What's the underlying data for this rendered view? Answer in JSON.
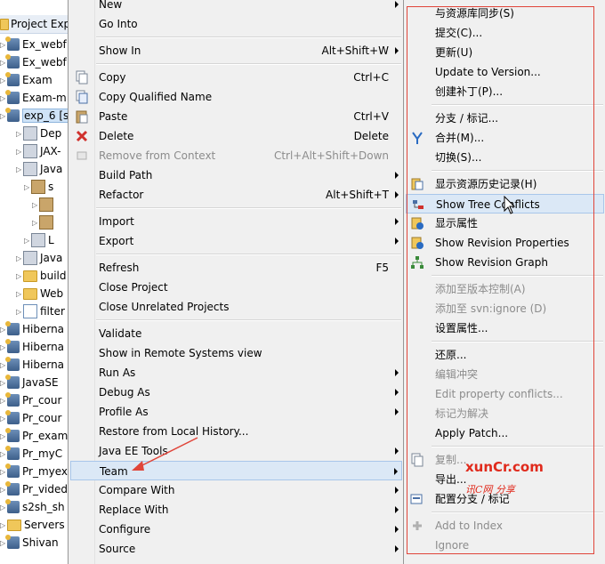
{
  "explorer": {
    "header": "Project Expl",
    "rows": [
      {
        "label": "Ex_webf",
        "indent": 0,
        "icon": "project-icon"
      },
      {
        "label": "Ex_webf",
        "indent": 0,
        "icon": "project-icon"
      },
      {
        "label": "Exam",
        "indent": 0,
        "icon": "project-icon"
      },
      {
        "label": "Exam-m",
        "indent": 0,
        "icon": "project-icon"
      },
      {
        "label": "exp_6 [s",
        "indent": 0,
        "icon": "project-icon",
        "selected": true
      },
      {
        "label": "Dep",
        "indent": 2,
        "icon": "library-icon"
      },
      {
        "label": "JAX-",
        "indent": 2,
        "icon": "library-icon"
      },
      {
        "label": "Java",
        "indent": 2,
        "icon": "library-icon"
      },
      {
        "label": "s",
        "indent": 3,
        "icon": "package-icon"
      },
      {
        "label": "",
        "indent": 4,
        "icon": "package-icon"
      },
      {
        "label": "",
        "indent": 4,
        "icon": "package-icon"
      },
      {
        "label": "L",
        "indent": 3,
        "icon": "library-icon"
      },
      {
        "label": "Java",
        "indent": 2,
        "icon": "library-icon"
      },
      {
        "label": "build",
        "indent": 2,
        "icon": "folder-icon"
      },
      {
        "label": "Web",
        "indent": 2,
        "icon": "folder-icon"
      },
      {
        "label": "filter",
        "indent": 2,
        "icon": "xml-icon"
      },
      {
        "label": "Hiberna",
        "indent": 0,
        "icon": "project-icon"
      },
      {
        "label": "Hiberna",
        "indent": 0,
        "icon": "project-icon"
      },
      {
        "label": "Hiberna",
        "indent": 0,
        "icon": "project-icon"
      },
      {
        "label": "JavaSE",
        "indent": 0,
        "icon": "project-icon"
      },
      {
        "label": "Pr_cour",
        "indent": 0,
        "icon": "project-icon"
      },
      {
        "label": "Pr_cour",
        "indent": 0,
        "icon": "project-icon"
      },
      {
        "label": "Pr_exam",
        "indent": 0,
        "icon": "project-icon"
      },
      {
        "label": "Pr_myC",
        "indent": 0,
        "icon": "project-icon"
      },
      {
        "label": "Pr_myex",
        "indent": 0,
        "icon": "project-icon"
      },
      {
        "label": "Pr_vided",
        "indent": 0,
        "icon": "project-icon"
      },
      {
        "label": "s2sh_sh",
        "indent": 0,
        "icon": "project-icon"
      },
      {
        "label": "Servers",
        "indent": 0,
        "icon": "folder-icon"
      },
      {
        "label": "Shivan",
        "indent": 0,
        "icon": "project-icon"
      }
    ]
  },
  "main_menu": {
    "items": [
      {
        "type": "item",
        "label": "New",
        "submenu": true
      },
      {
        "type": "item",
        "label": "Go Into"
      },
      {
        "type": "sep"
      },
      {
        "type": "item",
        "label": "Show In",
        "accel": "Alt+Shift+W",
        "submenu": true
      },
      {
        "type": "sep"
      },
      {
        "type": "item",
        "label": "Copy",
        "accel": "Ctrl+C",
        "icon": "copy-icon"
      },
      {
        "type": "item",
        "label": "Copy Qualified Name",
        "icon": "copy-qualified-icon"
      },
      {
        "type": "item",
        "label": "Paste",
        "accel": "Ctrl+V",
        "icon": "paste-icon"
      },
      {
        "type": "item",
        "label": "Delete",
        "accel": "Delete",
        "icon": "delete-icon"
      },
      {
        "type": "item",
        "label": "Remove from Context",
        "accel": "Ctrl+Alt+Shift+Down",
        "disabled": true,
        "icon": "remove-context-icon"
      },
      {
        "type": "item",
        "label": "Build Path",
        "submenu": true
      },
      {
        "type": "item",
        "label": "Refactor",
        "accel": "Alt+Shift+T",
        "submenu": true
      },
      {
        "type": "sep"
      },
      {
        "type": "item",
        "label": "Import",
        "submenu": true
      },
      {
        "type": "item",
        "label": "Export",
        "submenu": true
      },
      {
        "type": "sep"
      },
      {
        "type": "item",
        "label": "Refresh",
        "accel": "F5"
      },
      {
        "type": "item",
        "label": "Close Project"
      },
      {
        "type": "item",
        "label": "Close Unrelated Projects"
      },
      {
        "type": "sep"
      },
      {
        "type": "item",
        "label": "Validate"
      },
      {
        "type": "item",
        "label": "Show in Remote Systems view"
      },
      {
        "type": "item",
        "label": "Run As",
        "submenu": true
      },
      {
        "type": "item",
        "label": "Debug As",
        "submenu": true
      },
      {
        "type": "item",
        "label": "Profile As",
        "submenu": true
      },
      {
        "type": "item",
        "label": "Restore from Local History..."
      },
      {
        "type": "item",
        "label": "Java EE Tools",
        "submenu": true
      },
      {
        "type": "item",
        "label": "Team",
        "submenu": true,
        "highlight": true
      },
      {
        "type": "item",
        "label": "Compare With",
        "submenu": true
      },
      {
        "type": "item",
        "label": "Replace With",
        "submenu": true
      },
      {
        "type": "item",
        "label": "Configure",
        "submenu": true
      },
      {
        "type": "item",
        "label": "Source",
        "submenu": true
      }
    ]
  },
  "team_menu": {
    "items": [
      {
        "type": "item",
        "label": "与资源库同步(S)"
      },
      {
        "type": "item",
        "label": "提交(C)..."
      },
      {
        "type": "item",
        "label": "更新(U)"
      },
      {
        "type": "item",
        "label": "Update to Version..."
      },
      {
        "type": "item",
        "label": "创建补丁(P)..."
      },
      {
        "type": "sep"
      },
      {
        "type": "item",
        "label": "分支 / 标记..."
      },
      {
        "type": "item",
        "label": "合并(M)...",
        "icon": "merge-icon"
      },
      {
        "type": "item",
        "label": "切换(S)..."
      },
      {
        "type": "sep"
      },
      {
        "type": "item",
        "label": "显示资源历史记录(H)",
        "icon": "history-icon"
      },
      {
        "type": "item",
        "label": "Show Tree Conflicts",
        "icon": "tree-conflicts-icon",
        "hover": true
      },
      {
        "type": "item",
        "label": "显示属性",
        "icon": "properties-icon"
      },
      {
        "type": "item",
        "label": "Show Revision Properties",
        "icon": "revision-properties-icon"
      },
      {
        "type": "item",
        "label": "Show Revision Graph",
        "icon": "revision-graph-icon"
      },
      {
        "type": "sep"
      },
      {
        "type": "item",
        "label": "添加至版本控制(A)",
        "disabled": true
      },
      {
        "type": "item",
        "label": "添加至 svn:ignore (D)",
        "disabled": true
      },
      {
        "type": "item",
        "label": "设置属性..."
      },
      {
        "type": "sep"
      },
      {
        "type": "item",
        "label": "还原..."
      },
      {
        "type": "item",
        "label": "编辑冲突",
        "disabled": true
      },
      {
        "type": "item",
        "label": "Edit property conflicts...",
        "disabled": true
      },
      {
        "type": "item",
        "label": "标记为解决",
        "disabled": true
      },
      {
        "type": "item",
        "label": "Apply Patch..."
      },
      {
        "type": "sep"
      },
      {
        "type": "item",
        "label": "复制...",
        "disabled": true,
        "icon": "copy-icon"
      },
      {
        "type": "item",
        "label": "导出..."
      },
      {
        "type": "item",
        "label": "配置分支 / 标记",
        "icon": "configure-branches-icon"
      },
      {
        "type": "sep"
      },
      {
        "type": "item",
        "label": "Add to Index",
        "disabled": true,
        "icon": "add-index-icon"
      },
      {
        "type": "item",
        "label": "Ignore",
        "disabled": true
      }
    ]
  },
  "watermark": {
    "line1": "xunCr.com",
    "line2": "讯C网 分享"
  },
  "colors": {
    "menu_bg": "#f0f0f0",
    "highlight": "#dbe8f6",
    "annotation_red": "#e0453a",
    "disabled_text": "#8c8c8c"
  }
}
